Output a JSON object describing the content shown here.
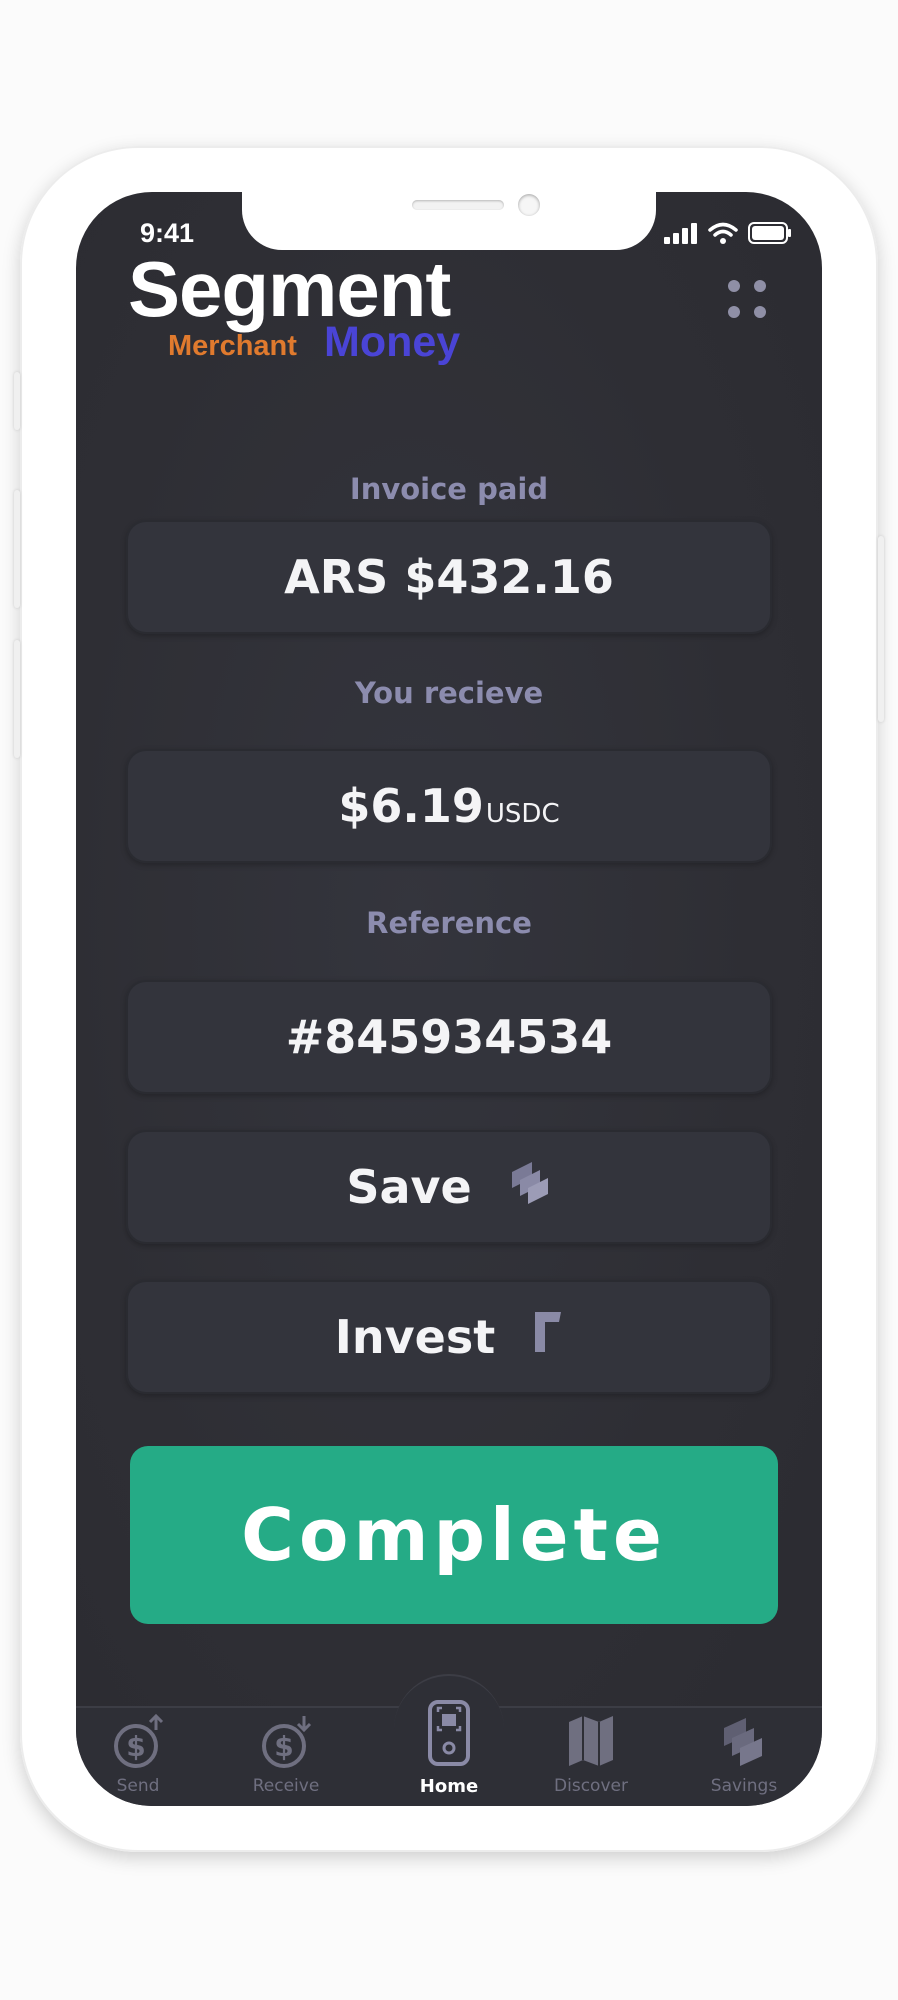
{
  "status": {
    "time": "9:41"
  },
  "brand": {
    "title": "Segment",
    "sub_left": "Merchant",
    "sub_right": "Money"
  },
  "fields": {
    "invoice_label": "Invoice paid",
    "invoice_value": "ARS $432.16",
    "receive_label": "You recieve",
    "receive_value": "$6.19",
    "receive_unit": "USDC",
    "reference_label": "Reference",
    "reference_value": "#845934534"
  },
  "actions": {
    "save_label": "Save",
    "invest_label": "Invest",
    "complete_label": "Complete"
  },
  "tabbar": {
    "items": [
      {
        "label": "Send",
        "icon": "send-dollar-icon"
      },
      {
        "label": "Receive",
        "icon": "receive-dollar-icon"
      },
      {
        "label": "Home",
        "icon": "scanner-phone-icon",
        "active": true
      },
      {
        "label": "Discover",
        "icon": "map-icon"
      },
      {
        "label": "Savings",
        "icon": "stack-icon"
      }
    ]
  },
  "colors": {
    "background": "#2f2f36",
    "field": "#33343c",
    "label": "#8c8cae",
    "accent": "#25ab86",
    "brand_orange": "#e07a2e",
    "brand_blue": "#4a44d6",
    "icon": "#8f8fa6"
  }
}
